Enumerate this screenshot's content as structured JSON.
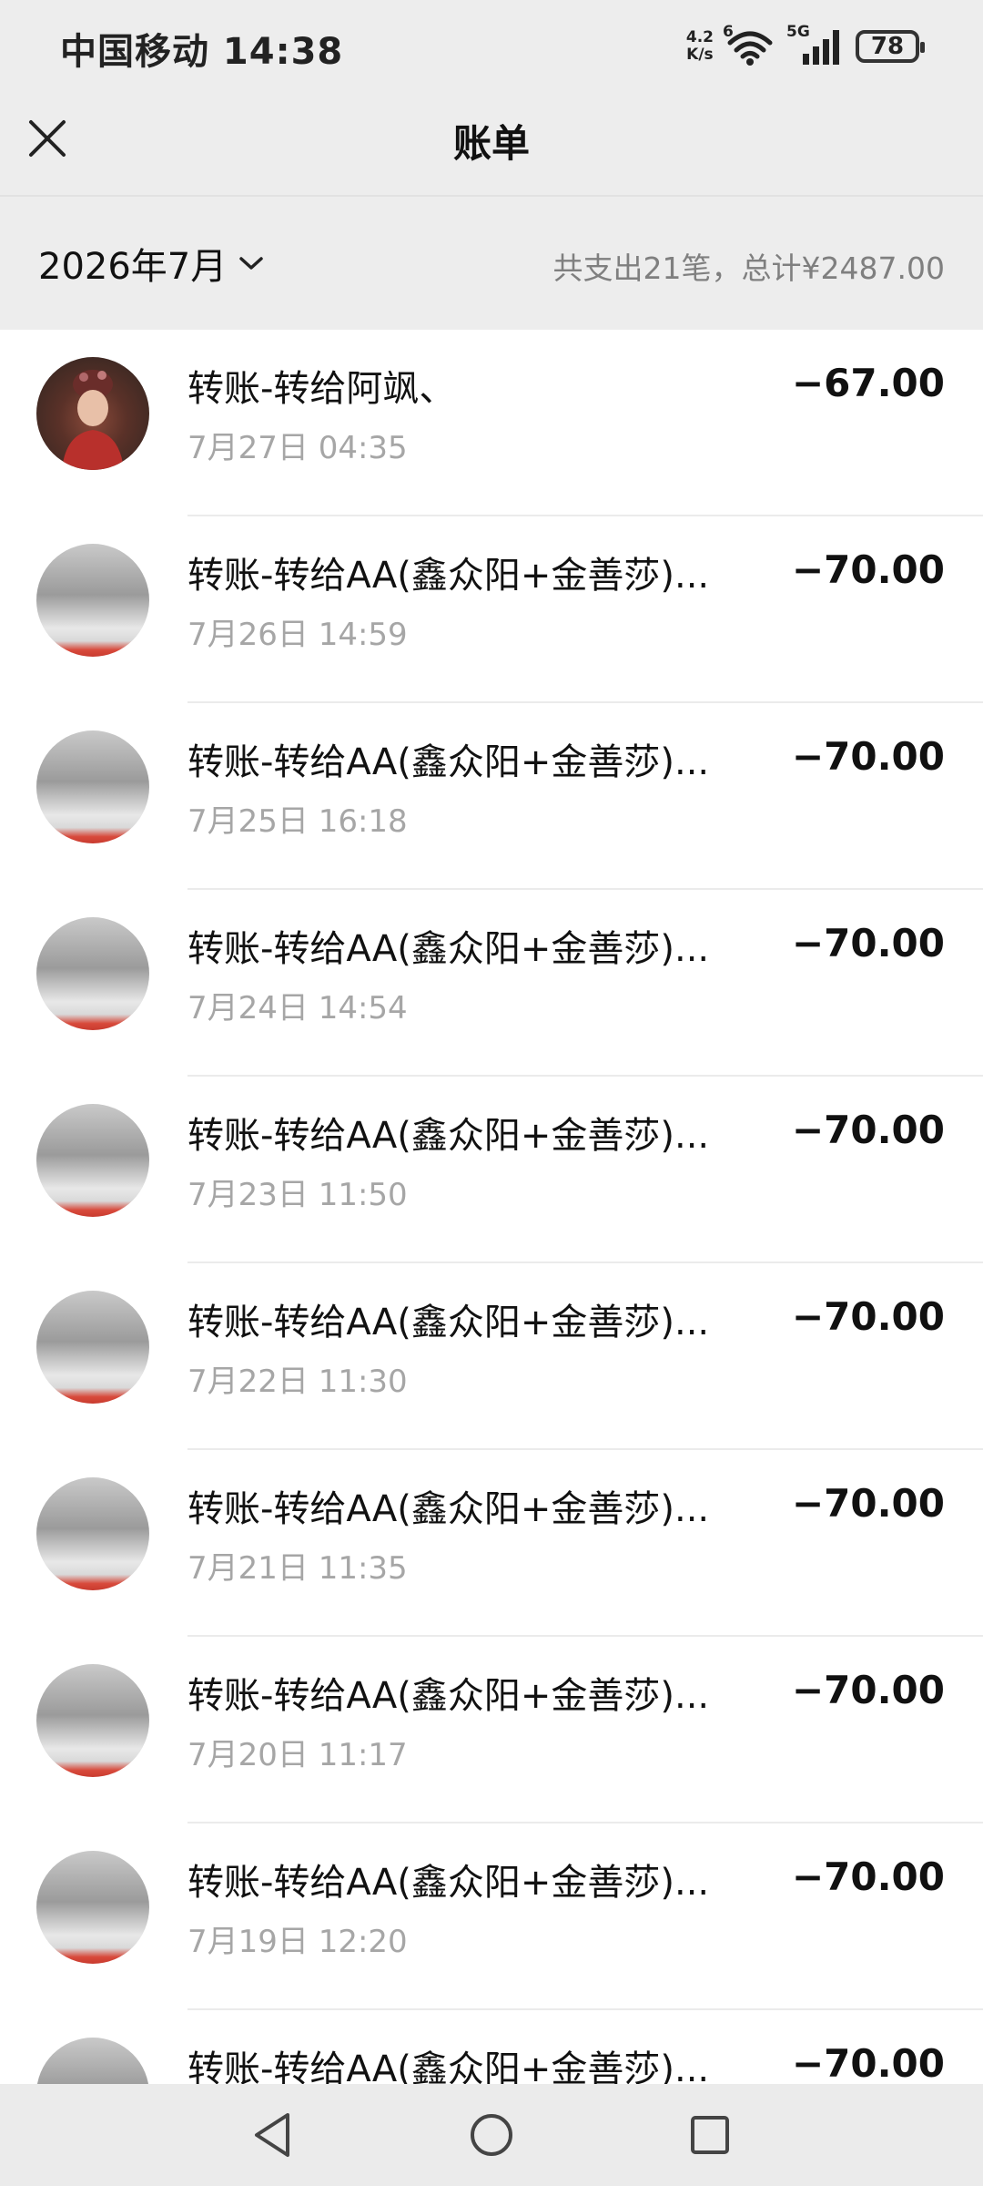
{
  "status_bar": {
    "carrier_time": "中国移动 14:38",
    "net_speed_value": "4.2",
    "net_speed_unit": "K/s",
    "wifi_sup": "6",
    "signal_sup": "5G",
    "battery": "78"
  },
  "header": {
    "title": "账单"
  },
  "summary": {
    "month": "2026年7月",
    "text": "共支出21笔，总计¥2487.00"
  },
  "transactions": [
    {
      "title": "转账-转给阿飒、",
      "time": "7月27日 04:35",
      "amount": "−67.00",
      "avatar": "person"
    },
    {
      "title": "转账-转给AA(鑫众阳+金善莎)...",
      "time": "7月26日 14:59",
      "amount": "−70.00",
      "avatar": "room"
    },
    {
      "title": "转账-转给AA(鑫众阳+金善莎)...",
      "time": "7月25日 16:18",
      "amount": "−70.00",
      "avatar": "room"
    },
    {
      "title": "转账-转给AA(鑫众阳+金善莎)...",
      "time": "7月24日 14:54",
      "amount": "−70.00",
      "avatar": "room"
    },
    {
      "title": "转账-转给AA(鑫众阳+金善莎)...",
      "time": "7月23日 11:50",
      "amount": "−70.00",
      "avatar": "room"
    },
    {
      "title": "转账-转给AA(鑫众阳+金善莎)...",
      "time": "7月22日 11:30",
      "amount": "−70.00",
      "avatar": "room"
    },
    {
      "title": "转账-转给AA(鑫众阳+金善莎)...",
      "time": "7月21日 11:35",
      "amount": "−70.00",
      "avatar": "room"
    },
    {
      "title": "转账-转给AA(鑫众阳+金善莎)...",
      "time": "7月20日 11:17",
      "amount": "−70.00",
      "avatar": "room"
    },
    {
      "title": "转账-转给AA(鑫众阳+金善莎)...",
      "time": "7月19日 12:20",
      "amount": "−70.00",
      "avatar": "room"
    },
    {
      "title": "转账-转给AA(鑫众阳+金善莎)...",
      "time": "",
      "amount": "−70.00",
      "avatar": "room"
    }
  ],
  "icons": {
    "close": "close-icon",
    "chevron": "chevron-down-icon",
    "back": "back-triangle-icon",
    "home": "home-circle-icon",
    "recents": "recents-square-icon"
  }
}
